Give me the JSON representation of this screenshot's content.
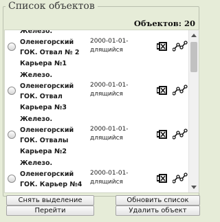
{
  "group_title": "Список объектов",
  "count": {
    "label": "Объектов:",
    "value": "20"
  },
  "items": [
    {
      "name": "Железо.\nОленегорский\nГОК. Отвал № 2\nКарьера №1",
      "date": "2000-01-01-\nдлящийся"
    },
    {
      "name": "Железо.\nОленегорский\nГОК. Отвал\nКарьера №3",
      "date": "2000-01-01-\nдлящийся"
    },
    {
      "name": "Железо.\nОленегорский\nГОК. Отвалы\nКарьера №2",
      "date": "2000-01-01-\nдлящийся"
    },
    {
      "name": "Железо.\nОленегорский\nГОК. Карьер №4",
      "date": "2000-01-01-\nдлящийся"
    }
  ],
  "icons": {
    "map": "map-icon",
    "route": "route-icon"
  },
  "buttons": {
    "deselect": "Снять выделение",
    "refresh": "Обновить список",
    "go": "Перейти",
    "delete": "Удалить объект"
  }
}
